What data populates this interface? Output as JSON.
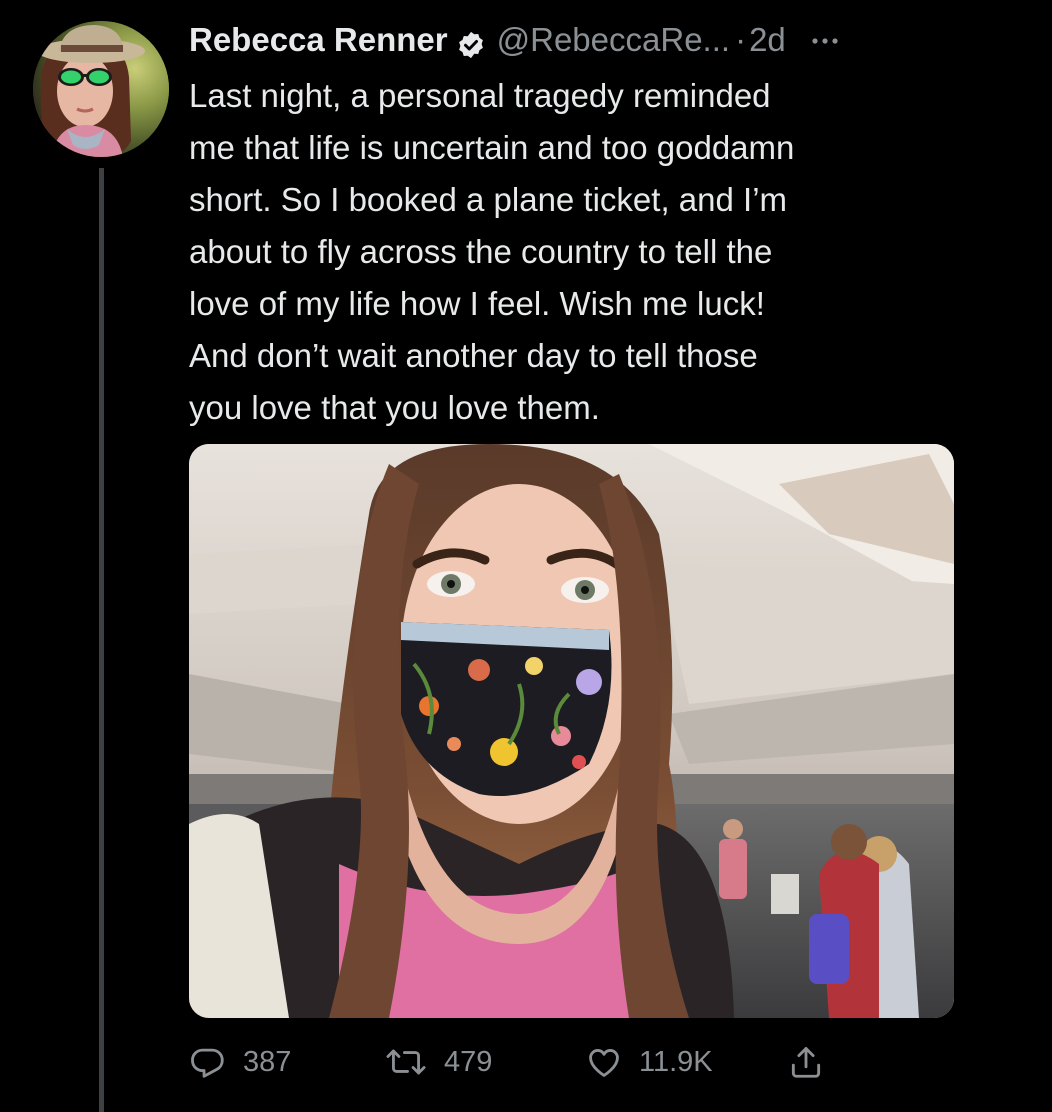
{
  "author": {
    "display_name": "Rebecca Renner",
    "handle": "@RebeccaRe...",
    "separator": "·",
    "timestamp": "2d",
    "verified": true
  },
  "tweet": {
    "lines": [
      "Last night, a personal tragedy reminded",
      "me that life is uncertain and too goddamn",
      "short. So I booked a plane ticket, and I’m",
      "about to fly across the country to tell the",
      "love of my life how I feel. Wish me luck!",
      "And don’t wait another day to tell those",
      "you love that you love them."
    ]
  },
  "actions": {
    "reply_count": "387",
    "retweet_count": "479",
    "like_count": "11.9K"
  },
  "icons": {
    "verified": "verified-badge-icon",
    "more": "more-horizontal-icon",
    "reply": "reply-icon",
    "retweet": "retweet-icon",
    "like": "heart-icon",
    "share": "share-icon"
  },
  "colors": {
    "background": "#000000",
    "text": "#e7e9ea",
    "secondary_text": "#8b9095",
    "thread_line": "#3e4144"
  }
}
